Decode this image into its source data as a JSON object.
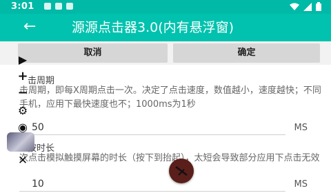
{
  "status_bar": {
    "time": "3:01"
  },
  "toolbar": {
    "title": "源源点击器3.0(内有悬浮窗)"
  },
  "actions": {
    "cancel_label": "取消",
    "confirm_label": "确定"
  },
  "settings": [
    {
      "title": "击周期",
      "description": "击周期，即每X周期点击一次。决定了点击速度，数值越小，速度越快；不同手机，应用下最快速度也不；1000ms为1秒",
      "value": "50",
      "unit": "MS"
    },
    {
      "title": "按时长",
      "description": "次点击模拟触摸屏幕的时长（按下到抬起），太短会导致部分应用下点击无效",
      "value": "10",
      "unit": "MS"
    }
  ],
  "floating_controls": {
    "icons": [
      "play-icon",
      "plus-icon",
      "minus-icon",
      "gear-icon",
      "eye-off-icon",
      "avatar-icon",
      "close-icon"
    ]
  },
  "colors": {
    "status_bar": "#00b9a6",
    "toolbar": "#00c2ae",
    "button_bg": "#d6d6d6"
  }
}
